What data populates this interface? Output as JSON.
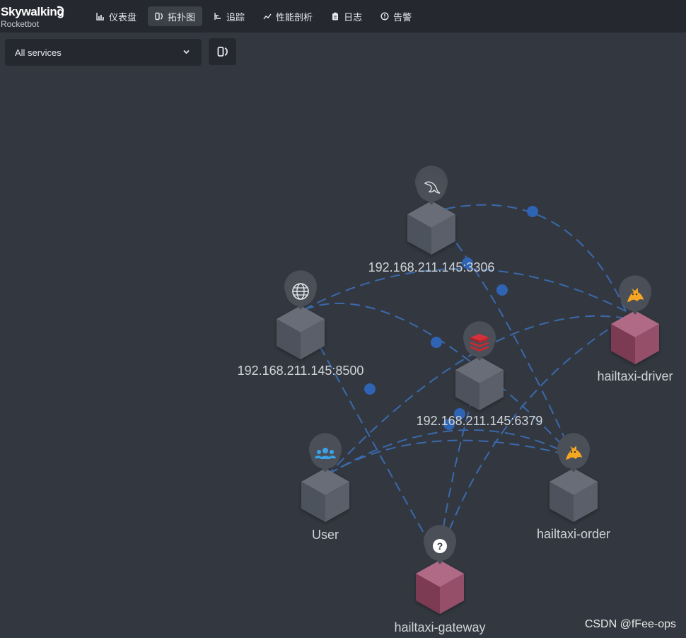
{
  "app": {
    "logo_title": "Skywalking",
    "logo_subtitle": "Rocketbot"
  },
  "nav": {
    "items": [
      {
        "label": "仪表盘",
        "icon": "bar-chart-icon",
        "active": false
      },
      {
        "label": "拓扑图",
        "icon": "topology-icon",
        "active": true
      },
      {
        "label": "追踪",
        "icon": "trace-icon",
        "active": false
      },
      {
        "label": "性能剖析",
        "icon": "trend-icon",
        "active": false
      },
      {
        "label": "日志",
        "icon": "clipboard-icon",
        "active": false
      },
      {
        "label": "告警",
        "icon": "alarm-icon",
        "active": false
      }
    ]
  },
  "filter": {
    "service_select_value": "All services"
  },
  "topology": {
    "nodes": [
      {
        "id": "mysql",
        "label": "192.168.211.145:3306",
        "icon": "mysql-dolphin-icon",
        "color": "#555a64"
      },
      {
        "id": "consul",
        "label": "192.168.211.145:8500",
        "icon": "globe-icon",
        "color": "#555a64"
      },
      {
        "id": "redis",
        "label": "192.168.211.145:6379",
        "icon": "redis-icon",
        "color": "#555a64"
      },
      {
        "id": "driver",
        "label": "hailtaxi-driver",
        "icon": "tomcat-icon",
        "color": "#9a4a63"
      },
      {
        "id": "user",
        "label": "User",
        "icon": "users-icon",
        "color": "#555a64"
      },
      {
        "id": "order",
        "label": "hailtaxi-order",
        "icon": "tomcat-icon",
        "color": "#555a64"
      },
      {
        "id": "gateway",
        "label": "hailtaxi-gateway",
        "icon": "question-icon",
        "color": "#9a4a63"
      }
    ],
    "edge_color": "#3b6fb8"
  },
  "watermark": "CSDN @fFee-ops"
}
